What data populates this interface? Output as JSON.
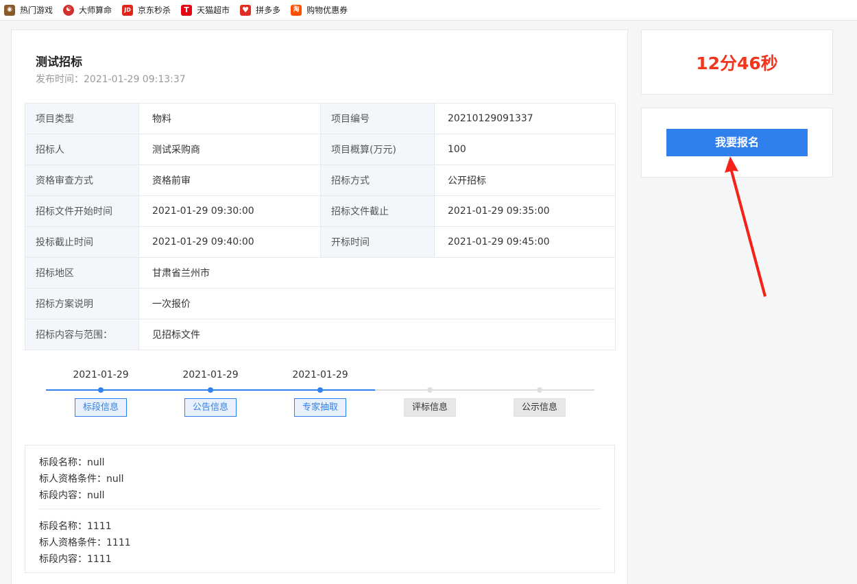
{
  "bookmarks": [
    {
      "label": "热门游戏",
      "icon": "game-icon",
      "color": "#8a5a2b",
      "glyph": "◉"
    },
    {
      "label": "大师算命",
      "icon": "yinyang-icon",
      "color": "#d32f2f",
      "glyph": "☯"
    },
    {
      "label": "京东秒杀",
      "icon": "jd-logo-icon",
      "color": "#e1251b",
      "glyph": "JD"
    },
    {
      "label": "天猫超市",
      "icon": "tmall-logo-icon",
      "color": "#e60012",
      "glyph": "T"
    },
    {
      "label": "拼多多",
      "icon": "pinduoduo-logo-icon",
      "color": "#e02e24",
      "glyph": "♥"
    },
    {
      "label": "购物优惠券",
      "icon": "taobao-logo-icon",
      "color": "#ff5000",
      "glyph": "淘"
    }
  ],
  "project": {
    "title": "测试招标",
    "publish_label": "发布时间：",
    "publish_time": "2021-01-29 09:13:37"
  },
  "info_rows": [
    {
      "k1": "项目类型",
      "v1": "物料",
      "k2": "项目编号",
      "v2": "20210129091337"
    },
    {
      "k1": "招标人",
      "v1": "测试采购商",
      "k2": "项目概算(万元)",
      "v2": "100"
    },
    {
      "k1": "资格审查方式",
      "v1": "资格前审",
      "k2": "招标方式",
      "v2": "公开招标"
    },
    {
      "k1": "招标文件开始时间",
      "v1": "2021-01-29 09:30:00",
      "k2": "招标文件截止",
      "v2": "2021-01-29 09:35:00"
    },
    {
      "k1": "投标截止时间",
      "v1": "2021-01-29 09:40:00",
      "k2": "开标时间",
      "v2": "2021-01-29 09:45:00"
    }
  ],
  "info_full_rows": [
    {
      "k": "招标地区",
      "v": "甘肃省兰州市"
    },
    {
      "k": "招标方案说明",
      "v": "一次报价"
    },
    {
      "k": "招标内容与范围：",
      "v": "见招标文件"
    }
  ],
  "timeline": [
    {
      "date": "2021-01-29",
      "label": "标段信息",
      "active": true
    },
    {
      "date": "2021-01-29",
      "label": "公告信息",
      "active": true
    },
    {
      "date": "2021-01-29",
      "label": "专家抽取",
      "active": true
    },
    {
      "date": "",
      "label": "评标信息",
      "active": false
    },
    {
      "date": "",
      "label": "公示信息",
      "active": false
    }
  ],
  "lots": [
    {
      "name": "标段名称：null",
      "qual": "标人资格条件：null",
      "content": "标段内容：null"
    },
    {
      "name": "标段名称：1111",
      "qual": "标人资格条件：1111",
      "content": "标段内容：1111"
    }
  ],
  "countdown": "12分46秒",
  "signup_label": "我要报名",
  "colors": {
    "accent": "#2f80ed",
    "timer": "#f0361e",
    "arrow": "#f5221c"
  }
}
